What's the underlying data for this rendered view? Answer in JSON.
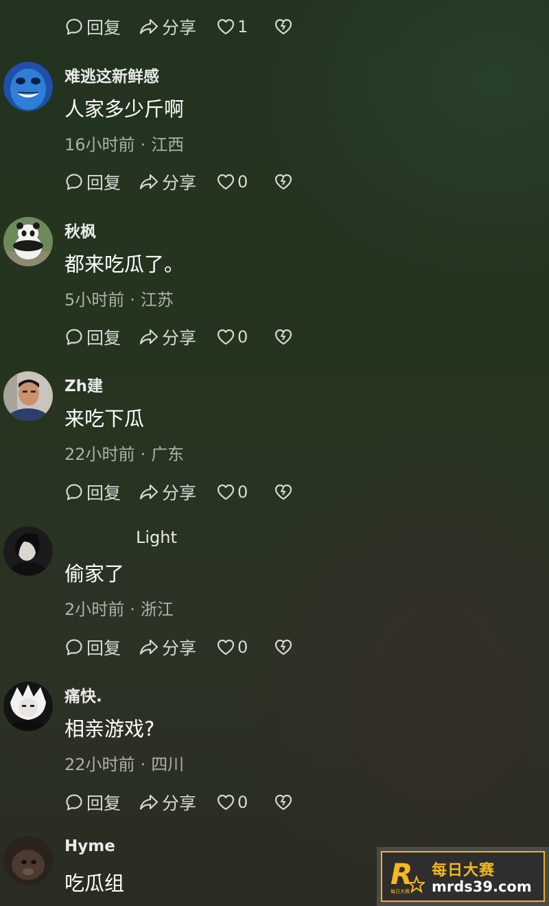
{
  "labels": {
    "reply": "回复",
    "share": "分享"
  },
  "top_actions": {
    "likes": "1"
  },
  "comments": [
    {
      "user": "难逃这新鲜感",
      "text": "人家多少斤啊",
      "time": "16小时前",
      "location": "江西",
      "likes": "0"
    },
    {
      "user": "秋枫",
      "text": "都来吃瓜了。",
      "time": "5小时前",
      "location": "江苏",
      "likes": "0"
    },
    {
      "user": "Zh建",
      "text": "来吃下瓜",
      "time": "22小时前",
      "location": "广东",
      "likes": "0"
    },
    {
      "user": "Light",
      "text": "偷家了",
      "time": "2小时前",
      "location": "浙江",
      "likes": "0"
    },
    {
      "user": "痛快.",
      "text": "相亲游戏?",
      "time": "22小时前",
      "location": "四川",
      "likes": "0"
    },
    {
      "user": "Hyme",
      "text": "吃瓜组"
    }
  ],
  "icons": [
    "comment-bubble-icon",
    "share-arrow-icon",
    "heart-icon",
    "broken-heart-icon"
  ],
  "watermark": {
    "title": "每日大赛",
    "url": "mrds39.com",
    "logo_letter": "R",
    "logo_small": "每日大赛",
    "accent": "#f5b81e"
  }
}
